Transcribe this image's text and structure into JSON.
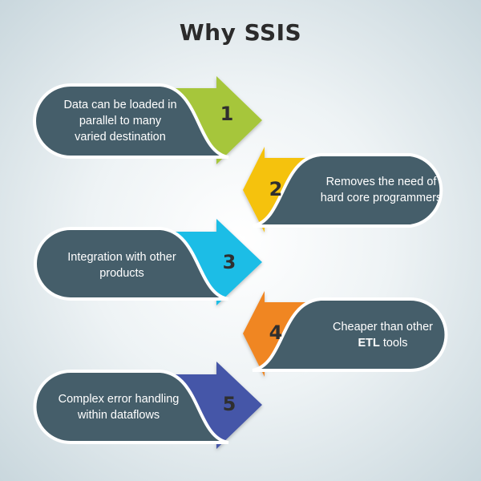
{
  "title": "Why SSIS",
  "items": [
    {
      "number": "1",
      "lines": [
        "Data can be loaded in",
        "parallel to many",
        "varied destination"
      ],
      "color": "#a6c63b",
      "side": "left"
    },
    {
      "number": "2",
      "lines": [
        "Removes the need of",
        "hard core programmers"
      ],
      "color": "#f5c211",
      "side": "right"
    },
    {
      "number": "3",
      "lines": [
        "Integration with other",
        "products"
      ],
      "color": "#1fbde6",
      "side": "left"
    },
    {
      "number": "4",
      "text_before_bold": "Cheaper than other",
      "bold": "ETL",
      "text_after_bold": " tools",
      "color": "#f08623",
      "side": "right"
    },
    {
      "number": "5",
      "lines": [
        "Complex error handling",
        "within dataflows"
      ],
      "color": "#4556a8",
      "side": "left"
    }
  ],
  "colors": {
    "pill": "#455e6a",
    "pill_border": "#ffffff"
  }
}
